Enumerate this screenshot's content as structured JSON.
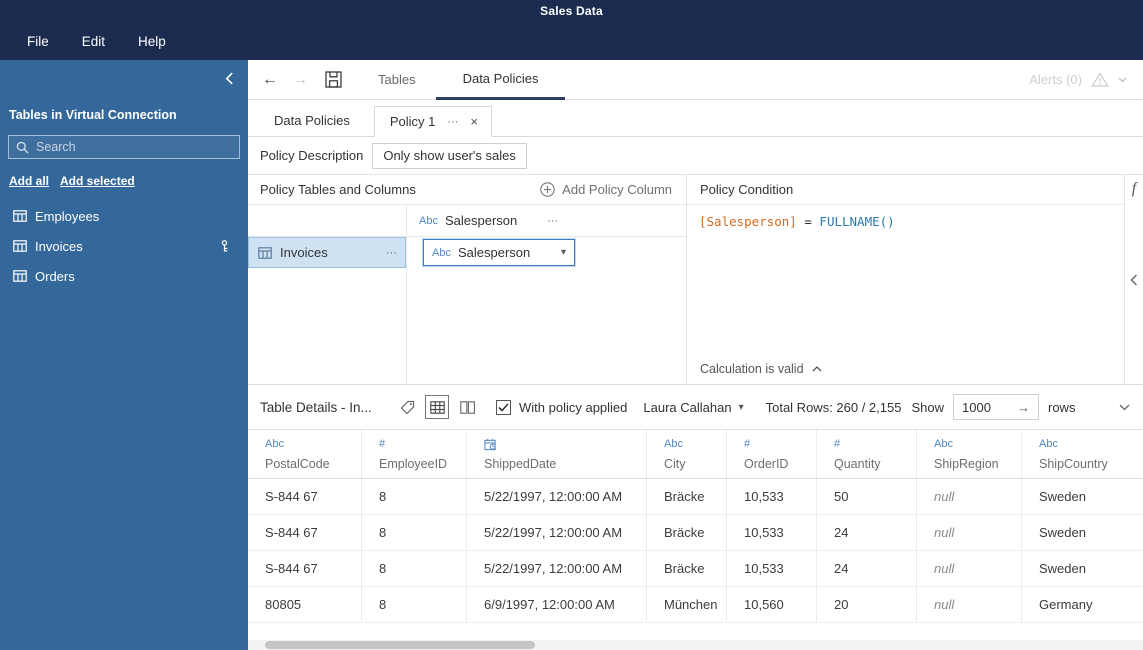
{
  "icons": {
    "back": "←",
    "forward": "→",
    "ellipsis": "···",
    "close": "×",
    "caret": "▾",
    "fx": "f"
  },
  "titlebar": {
    "title": "Sales Data",
    "menus": [
      "File",
      "Edit",
      "Help"
    ]
  },
  "sidebar": {
    "header": "Tables in Virtual Connection",
    "search_placeholder": "Search",
    "links": [
      "Add all",
      "Add selected"
    ],
    "tables": [
      {
        "name": "Employees",
        "has_key": false
      },
      {
        "name": "Invoices",
        "has_key": true
      },
      {
        "name": "Orders",
        "has_key": false
      }
    ]
  },
  "toolbar": {
    "tabs": [
      {
        "label": "Tables",
        "active": false
      },
      {
        "label": "Data Policies",
        "active": true
      }
    ],
    "alerts_label": "Alerts (0)"
  },
  "doc_tabs": {
    "home": "Data Policies",
    "policy": "Policy 1"
  },
  "policy": {
    "description_label": "Policy Description",
    "description_value": "Only show user's sales",
    "tables_header": "Policy Tables and Columns",
    "add_column_label": "Add Policy Column",
    "condition_header": "Policy Condition",
    "column_type": "Abc",
    "column_header": "Salesperson",
    "table_row": {
      "name": "Invoices",
      "column": "Salesperson"
    },
    "condition": [
      "[Salesperson]",
      " = ",
      "FULLNAME()"
    ],
    "validation": "Calculation is valid"
  },
  "table_details": {
    "title": "Table Details - In...",
    "with_policy_label": "With policy applied",
    "user_filter": "Laura Callahan",
    "total_rows": "Total Rows: 260 / 2,155",
    "show_label": "Show",
    "show_value": "1000",
    "rows_label": "rows",
    "columns": [
      {
        "name": "PostalCode",
        "type": "Abc"
      },
      {
        "name": "EmployeeID",
        "type": "#"
      },
      {
        "name": "ShippedDate",
        "type": "date"
      },
      {
        "name": "City",
        "type": "Abc"
      },
      {
        "name": "OrderID",
        "type": "#"
      },
      {
        "name": "Quantity",
        "type": "#"
      },
      {
        "name": "ShipRegion",
        "type": "Abc"
      },
      {
        "name": "ShipCountry",
        "type": "Abc"
      }
    ],
    "rows": [
      [
        "S-844 67",
        "8",
        "5/22/1997, 12:00:00 AM",
        "Bräcke",
        "10,533",
        "50",
        "null",
        "Sweden"
      ],
      [
        "S-844 67",
        "8",
        "5/22/1997, 12:00:00 AM",
        "Bräcke",
        "10,533",
        "24",
        "null",
        "Sweden"
      ],
      [
        "S-844 67",
        "8",
        "5/22/1997, 12:00:00 AM",
        "Bräcke",
        "10,533",
        "24",
        "null",
        "Sweden"
      ],
      [
        "80805",
        "8",
        "6/9/1997, 12:00:00 AM",
        "München",
        "10,560",
        "20",
        "null",
        "Germany"
      ]
    ]
  },
  "colors": {
    "topbar": "#1b2c50",
    "sidebar": "#35689a",
    "selection": "#cfe2f3",
    "focus_blue": "#3a7fc1",
    "field_orange": "#d2691e",
    "function_blue": "#2a7ab0",
    "type_icon_blue": "#4f86c6"
  }
}
